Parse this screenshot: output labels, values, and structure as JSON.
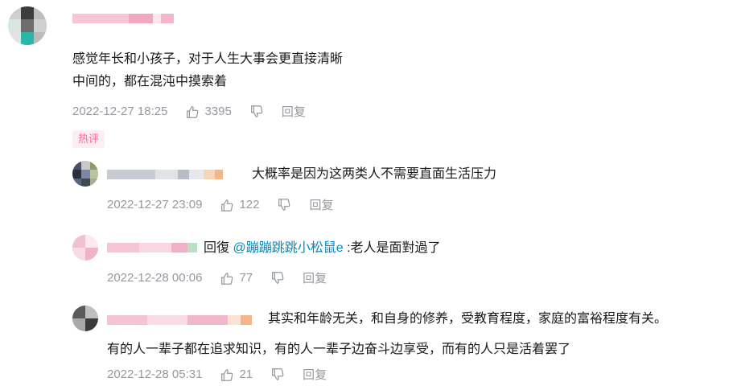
{
  "colors": {
    "text": "#18191c",
    "meta": "#9499a0",
    "link": "#008ac5",
    "tag_text": "#ff6699",
    "tag_bg": "#fdeef2"
  },
  "comment": {
    "text_line1": "感觉年长和小孩子，对于人生大事会更直接清晰",
    "text_line2": "中间的，都在混沌中摸索着",
    "time": "2022-12-27 18:25",
    "likes": "3395",
    "reply_label": "回复",
    "tag": "热评"
  },
  "replies": [
    {
      "text": "大概率是因为这两类人不需要直面生活压力",
      "time": "2022-12-27 23:09",
      "likes": "122",
      "reply_label": "回复"
    },
    {
      "prefix": "回復",
      "mention": "@蹦蹦跳跳小松鼠e",
      "text": ":老人是面對過了",
      "time": "2022-12-28 00:06",
      "likes": "77",
      "reply_label": "回复"
    },
    {
      "text_line1": "其实和年龄无关，和自身的修养，受教育程度，家庭的富裕程度有关。",
      "text_line2": "有的人一辈子都在追求知识，有的人一辈子边奋斗边享受，而有的人只是活着罢了",
      "time": "2022-12-28 05:31",
      "likes": "21",
      "reply_label": "回复"
    }
  ],
  "icons": {
    "like": "thumbs-up-icon",
    "dislike": "thumbs-down-icon"
  }
}
